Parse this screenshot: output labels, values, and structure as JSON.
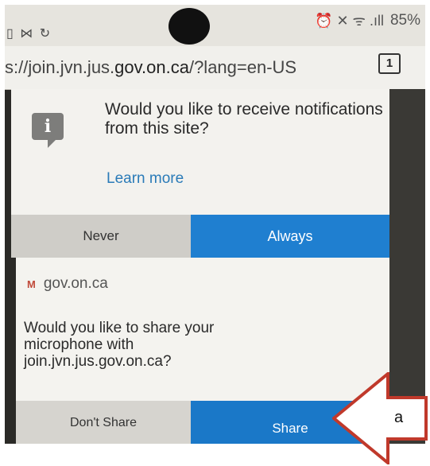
{
  "statusbar": {
    "left_icons": "▯ ⋈ ↻",
    "right_icons": "⏰ ✕ ᯤ .ıll",
    "battery": "85%"
  },
  "urlbar": {
    "url_prefix": "s://join.jvn.jus.",
    "url_domain": "gov.on.ca",
    "url_suffix": "/?lang=en-US",
    "tab_count": "1"
  },
  "notification_prompt": {
    "message": "Would you like to receive notifications from this site?",
    "learn_more": "Learn more",
    "never_label": "Never",
    "always_label": "Always"
  },
  "microphone_prompt": {
    "site_icon": "M",
    "site": "gov.on.ca",
    "message": "Would you like to share your microphone with join.jvn.jus.gov.on.ca?",
    "dont_share_label": "Don't Share",
    "share_label": "Share"
  },
  "annotation": {
    "label": "a",
    "arrow_color": "#c0392b"
  }
}
